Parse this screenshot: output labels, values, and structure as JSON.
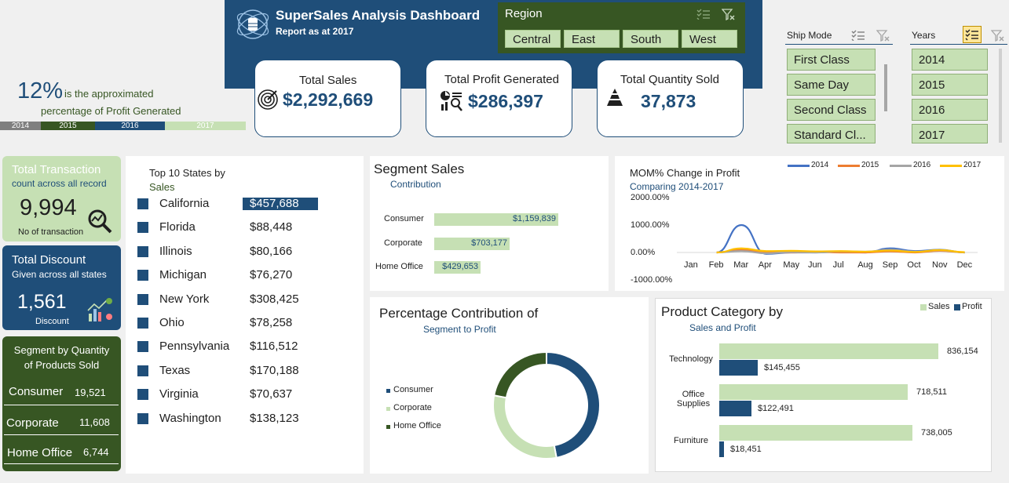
{
  "header": {
    "title": "SuperSales Analysis Dashboard",
    "subtitle": "Report as at 2017"
  },
  "region": {
    "title": "Region",
    "options": [
      "Central",
      "East",
      "South",
      "West"
    ]
  },
  "kpis": {
    "sales": {
      "label": "Total Sales",
      "value": "$2,292,669"
    },
    "profit": {
      "label_a": "Total Profit ",
      "label_b": "Generated",
      "value": "$286,397"
    },
    "quantity": {
      "label_a": "Total Quantity ",
      "label_b": "Sold",
      "value": "37,873"
    }
  },
  "profit_pct": {
    "value": "12%",
    "text1": "is the approximated",
    "text2": "percentage of Profit Generated"
  },
  "year_bar": [
    "2014",
    "2015",
    "2016",
    "2017"
  ],
  "ship_mode": {
    "title": "Ship Mode",
    "options": [
      "First Class",
      "Same Day",
      "Second Class",
      "Standard Cl..."
    ]
  },
  "years": {
    "title": "Years",
    "options": [
      "2014",
      "2015",
      "2016",
      "2017"
    ]
  },
  "transactions": {
    "title": "Total Transaction",
    "subtitle": "count across all record",
    "value": "9,994",
    "footer": "No of transaction"
  },
  "discount": {
    "title": "Total Discount",
    "subtitle": "Given across all states",
    "value": "1,561",
    "footer": "Discount"
  },
  "seg_qty": {
    "title1": "Segment by Quantity",
    "title2": "of Products Sold",
    "rows": [
      {
        "name": "Consumer",
        "value": "19,521"
      },
      {
        "name": "Corporate",
        "value": "11,608"
      },
      {
        "name": "Home Office",
        "value": "6,744"
      }
    ]
  },
  "top_states": {
    "title1": "Top 10 States by",
    "title2": "Sales",
    "rows": [
      {
        "name": "California",
        "value": "$457,688"
      },
      {
        "name": "Florida",
        "value": "$88,448"
      },
      {
        "name": "Illinois",
        "value": "$80,166"
      },
      {
        "name": "Michigan",
        "value": "$76,270"
      },
      {
        "name": "New York",
        "value": "$308,425"
      },
      {
        "name": "Ohio",
        "value": "$78,258"
      },
      {
        "name": "Pennsylvania",
        "value": "$116,512"
      },
      {
        "name": "Texas",
        "value": "$170,188"
      },
      {
        "name": "Virginia",
        "value": "$70,637"
      },
      {
        "name": "Washington",
        "value": "$138,123"
      }
    ]
  },
  "segment_sales": {
    "title": "Segment Sales",
    "subtitle": "Contribution",
    "rows": [
      {
        "name": "Consumer",
        "value": 1159839,
        "label": "$1,159,839"
      },
      {
        "name": "Corporate",
        "value": 703177,
        "label": "$703,177"
      },
      {
        "name": "Home Office",
        "value": 429653,
        "label": "$429,653"
      }
    ]
  },
  "mom": {
    "title": "MOM% Change in Profit",
    "subtitle": "Comparing 2014-2017",
    "y_ticks": [
      "2000.00%",
      "1000.00%",
      "0.00%",
      "-1000.00%"
    ],
    "months": [
      "Jan",
      "Feb",
      "Mar",
      "Apr",
      "May",
      "Jun",
      "Jul",
      "Aug",
      "Sep",
      "Oct",
      "Nov",
      "Dec"
    ],
    "legend": [
      "2014",
      "2015",
      "2016",
      "2017"
    ],
    "colors": [
      "#4472c4",
      "#ed7d31",
      "#a5a5a5",
      "#ffc000"
    ]
  },
  "pct_contrib": {
    "title": "Percentage Contribution of",
    "subtitle": "Segment to Profit",
    "legend": [
      "Consumer",
      "Corporate",
      "Home Office"
    ],
    "colors": [
      "#1f4e79",
      "#c6e0b4",
      "#375623"
    ]
  },
  "product_cat": {
    "title": "Product Category by",
    "subtitle": "Sales and Profit",
    "legend": [
      "Sales",
      "Profit"
    ],
    "categories": [
      "Technology",
      "Office Supplies",
      "Furniture"
    ],
    "sales": [
      836154,
      718511,
      738005
    ],
    "profit": [
      145455,
      122491,
      18451
    ],
    "sales_labels": [
      "836,154",
      "718,511",
      "738,005"
    ],
    "profit_labels": [
      "$145,455",
      "$122,491",
      "$18,451"
    ]
  },
  "chart_data": [
    {
      "type": "bar",
      "title": "Segment Sales",
      "categories": [
        "Consumer",
        "Corporate",
        "Home Office"
      ],
      "values": [
        1159839,
        703177,
        429653
      ]
    },
    {
      "type": "line",
      "title": "MOM% Change in Profit",
      "x": [
        "Jan",
        "Feb",
        "Mar",
        "Apr",
        "May",
        "Jun",
        "Jul",
        "Aug",
        "Sep",
        "Oct",
        "Nov",
        "Dec"
      ],
      "ylim": [
        -1000,
        2000
      ],
      "series": [
        {
          "name": "2014",
          "values": [
            null,
            0,
            1000,
            -50,
            0,
            0,
            30,
            0,
            150,
            50,
            100,
            0
          ]
        },
        {
          "name": "2015",
          "values": [
            null,
            0,
            100,
            0,
            0,
            20,
            0,
            0,
            40,
            0,
            60,
            0
          ]
        },
        {
          "name": "2016",
          "values": [
            null,
            0,
            50,
            -30,
            10,
            0,
            40,
            30,
            100,
            30,
            80,
            0
          ]
        },
        {
          "name": "2017",
          "values": [
            null,
            0,
            150,
            50,
            60,
            40,
            50,
            30,
            70,
            20,
            90,
            10
          ]
        }
      ]
    },
    {
      "type": "pie",
      "title": "Percentage Contribution of",
      "categories": [
        "Consumer",
        "Corporate",
        "Home Office"
      ],
      "values": [
        47,
        31,
        22
      ]
    },
    {
      "type": "bar",
      "title": "Product Category by",
      "categories": [
        "Technology",
        "Office Supplies",
        "Furniture"
      ],
      "series": [
        {
          "name": "Sales",
          "values": [
            836154,
            718511,
            738005
          ]
        },
        {
          "name": "Profit",
          "values": [
            145455,
            122491,
            18451
          ]
        }
      ]
    }
  ]
}
